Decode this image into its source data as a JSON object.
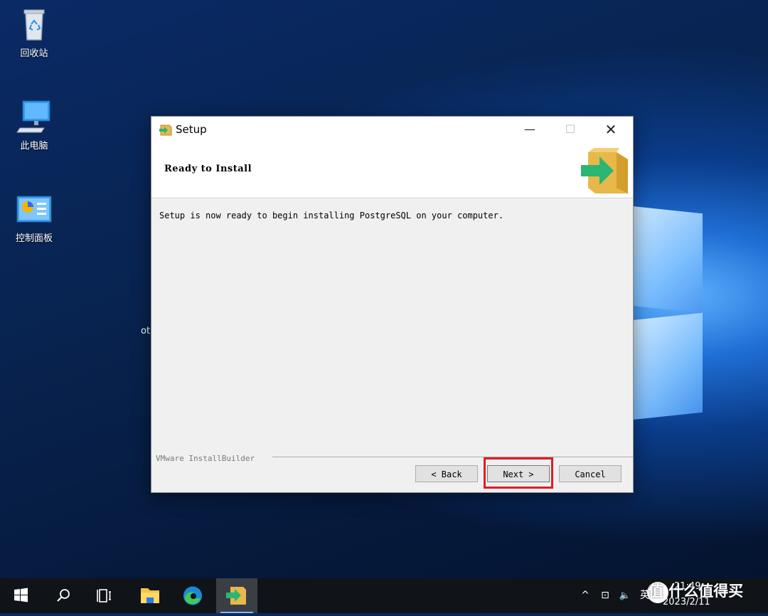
{
  "desktop": {
    "icons": [
      {
        "label": "回收站",
        "icon": "recycle-bin-icon"
      },
      {
        "label": "此电脑",
        "icon": "computer-icon"
      },
      {
        "label": "控制面板",
        "icon": "control-panel-icon"
      }
    ],
    "stray_text": "ot"
  },
  "dialog": {
    "window_title": "Setup",
    "page_title": "Ready to Install",
    "message": "Setup is now ready to begin installing PostgreSQL on your computer.",
    "branding": "VMware InstallBuilder",
    "buttons": {
      "back": "< Back",
      "next": "Next >",
      "cancel": "Cancel"
    },
    "controls": {
      "minimize": "—",
      "maximize": "☐",
      "close": "✕"
    }
  },
  "taskbar": {
    "items": [
      "start-icon",
      "search-icon",
      "task-view-icon",
      "file-explorer-icon",
      "edge-icon",
      "setup-app-icon"
    ],
    "tray": {
      "chevron": "^",
      "network": "⊡",
      "volume": "🔈",
      "ime": "英"
    },
    "time": "21:49",
    "date": "2023/2/11"
  },
  "watermark": "值 什么值得买",
  "colors": {
    "highlight": "#e21c24",
    "accent_green": "#2bb673",
    "box_tan": "#e8b84a"
  }
}
